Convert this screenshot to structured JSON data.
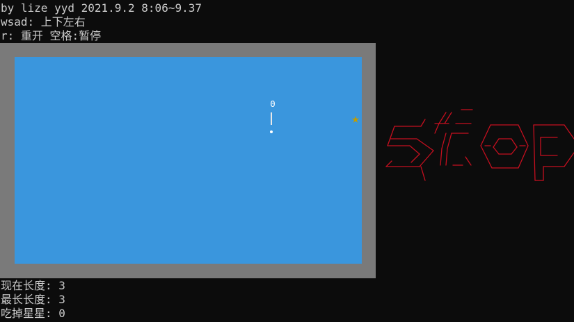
{
  "header": {
    "credit": "by lize yyd 2021.9.2 8:06~9.37",
    "controls_move": "wsad: 上下左右",
    "controls_other": "r: 重开 空格:暂停"
  },
  "game": {
    "snake_head_glyph": "Θ",
    "star_glyph": "★",
    "status_word": "stop",
    "colors": {
      "board": "#3a96dd",
      "border": "#7a7a7a",
      "star": "#c19c00",
      "stop_art": "#c50f1f",
      "background": "#0c0c0c",
      "text": "#cccccc"
    }
  },
  "stats": {
    "current_length": "现在长度: 3",
    "max_length": "最长长度: 3",
    "stars_eaten": "吃掉星星: 0"
  }
}
